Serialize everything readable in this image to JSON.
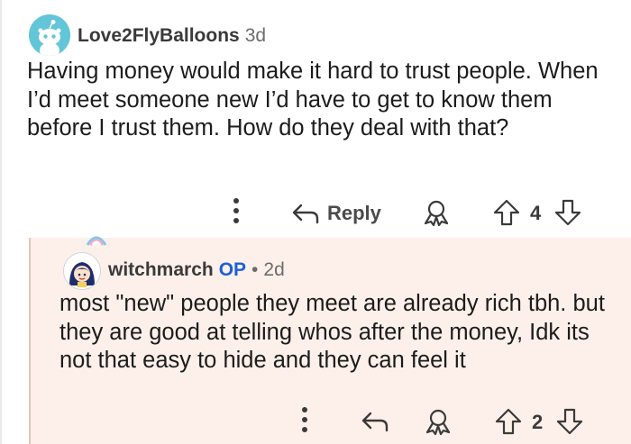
{
  "comment": {
    "author": "Love2FlyBalloons",
    "time": "3d",
    "text": "Having money would make it hard to trust people. When I’d meet someone new I’d have to get to know them before I trust them. How do they deal with that?",
    "actions": {
      "more_icon": "more-vertical-icon",
      "reply_label": "Reply",
      "award_icon": "award-icon",
      "score": "4"
    }
  },
  "reply": {
    "author": "witchmarch",
    "op_badge": "OP",
    "separator": "•",
    "time": "2d",
    "text": "most \"new\" people they meet are already rich tbh. but they are good at telling whos after the money, Idk its not that easy to hide and they can feel it",
    "actions": {
      "score": "2"
    }
  },
  "colors": {
    "reply_background": "#fdf0ea",
    "op_blue": "#1d5fd8",
    "avatar_teal": "#63c6d8"
  }
}
